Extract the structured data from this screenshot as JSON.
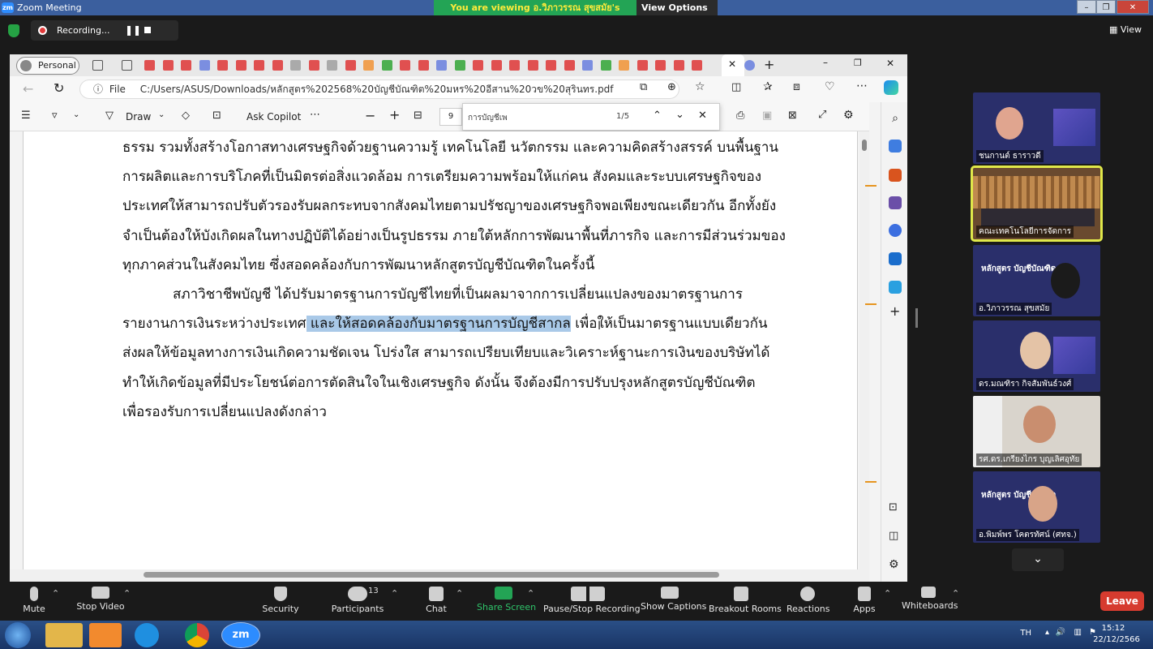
{
  "window": {
    "title": "Zoom Meeting",
    "viewing_banner": "You are viewing อ.วิภาวรรณ สุขสมัย's screen",
    "view_options": "View Options",
    "view_label": "View"
  },
  "recording": {
    "label": "Recording..."
  },
  "browser": {
    "profile": "Personal",
    "file_label": "File",
    "url": "C:/Users/ASUS/Downloads/หลักสูตร%202568%20บัญชีบัณฑิต%20มหร%20อีสาน%20วข%20สุรินทร.pdf",
    "pdf_toolbar": {
      "draw": "Draw",
      "ask_copilot": "Ask Copilot",
      "page_number": "9"
    },
    "find": {
      "query": "การบัญชีเพ",
      "count": "1/5"
    }
  },
  "pdf": {
    "lines": [
      "ธรรม รวมทั้งสร้างโอกาสทางเศรษฐกิจด้วยฐานความรู้ เทคโนโลยี นวัตกรรม และความคิดสร้างสรรค์ บนพื้นฐาน",
      "การผลิตและการบริโภคที่เป็นมิตรต่อสิ่งแวดล้อม การเตรียมความพร้อมให้แก่คน สังคมและระบบเศรษฐกิจของ",
      "ประเทศให้สามารถปรับตัวรองรับผลกระทบจากสังคมไทยตามปรัชญาของเศรษฐกิจพอเพียงขณะเดียวกัน อีกทั้งยัง",
      "จำเป็นต้องให้บังเกิดผลในทางปฏิบัติได้อย่างเป็นรูปธรรม ภายใต้หลักการพัฒนาพื้นที่ภารกิจ และการมีส่วนร่วมของ",
      "ทุกภาคส่วนในสังคมไทย ซึ่งสอดคล้องกับการพัฒนาหลักสูตรบัญชีบัณฑิตในครั้งนี้",
      "สภาวิชาชีพบัญชี ได้ปรับมาตรฐานการบัญชีไทยที่เป็นผลมาจากการเปลี่ยนแปลงของมาตรฐานการ"
    ],
    "line7_before": "รายงานการเงินระหว่างประเทศ",
    "line7_highlight": " และให้สอดคล้องกับมาตรฐานการบัญชีสากล",
    "line7_after": " เพื่อให้เป็นมาตรฐานแบบเดียวกัน",
    "lines_end": [
      "ส่งผลให้ข้อมูลทางการเงินเกิดความชัดเจน โปร่งใส สามารถเปรียบเทียบและวิเคราะห์ฐานะการเงินของบริษัทได้",
      "ทำให้เกิดข้อมูลที่มีประโยชน์ต่อการตัดสินใจในเชิงเศรษฐกิจ ดังนั้น จึงต้องมีการปรับปรุงหลักสูตรบัญชีบัณฑิต",
      "เพื่อรองรับการเปลี่ยนแปลงดังกล่าว"
    ]
  },
  "participants_gallery": [
    {
      "name": "ชนกานต์ ธาราวดี"
    },
    {
      "name": "คณะเทคโนโลยีการจัดการ"
    },
    {
      "name": "อ.วิภาวรรณ สุขสมัย"
    },
    {
      "name": "ดร.มณฑิรา กิจสัมพันธ์วงศ์"
    },
    {
      "name": "รศ.ดร.เกรียงไกร บุญเลิศอุทัย"
    },
    {
      "name": "อ.พิมพ์พร โคตรทัศน์ (ศทจ.)"
    }
  ],
  "thumb_title": "หลักสูตร บัญชีบัณฑิต",
  "controls": {
    "mute": "Mute",
    "stop_video": "Stop Video",
    "security": "Security",
    "participants": "Participants",
    "participants_count": "13",
    "chat": "Chat",
    "share_screen": "Share Screen",
    "pause_recording": "Pause/Stop Recording",
    "captions": "Show Captions",
    "breakout": "Breakout Rooms",
    "reactions": "Reactions",
    "apps": "Apps",
    "whiteboards": "Whiteboards",
    "leave": "Leave"
  },
  "taskbar": {
    "lang": "TH",
    "time": "15:12",
    "date": "22/12/2566"
  },
  "colors": {
    "zoom_blue": "#2d8cff",
    "share_green": "#23a455",
    "leave_red": "#d63b2f",
    "highlight": "#a9c9e8"
  }
}
